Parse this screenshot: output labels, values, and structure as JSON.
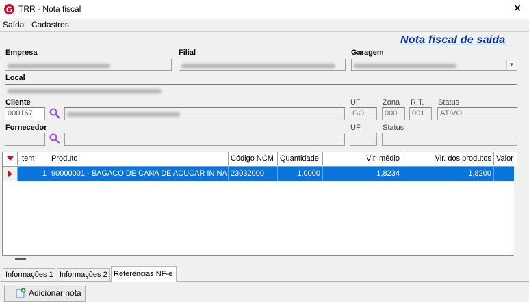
{
  "window": {
    "title": "TRR - Nota fiscal",
    "close_glyph": "✕",
    "app_icon_letter": "G"
  },
  "menu": {
    "items": [
      {
        "label": "Saída"
      },
      {
        "label": "Cadastros"
      }
    ]
  },
  "form": {
    "title": "Nota fiscal de saída",
    "empresa_label": "Empresa",
    "filial_label": "Filial",
    "garagem_label": "Garagem",
    "local_label": "Local",
    "cliente_label": "Cliente",
    "cliente_code": "000167",
    "uf_label": "UF",
    "uf_value": "GO",
    "zona_label": "Zona",
    "zona_value": "000",
    "rt_label": "R.T.",
    "rt_value": "001",
    "status_label": "Status",
    "status_value": "ATIVO",
    "fornecedor_label": "Fornecedor",
    "fornecedor_uf_label": "UF",
    "fornecedor_status_label": "Status"
  },
  "grid": {
    "columns": [
      "Item",
      "Produto",
      "Código NCM",
      "Quantidade",
      "Vlr. médio",
      "Vlr. dos produtos",
      "Valor"
    ],
    "rows": [
      {
        "item": "1",
        "produto": "90000001 - BAGACO DE CANA DE ACUCAR IN NA...",
        "ncm": "23032000",
        "quantidade": "1,0000",
        "vlr_medio": "1,8234",
        "vlr_produtos": "1,8200",
        "valor": ""
      }
    ]
  },
  "tabs": [
    {
      "label": "Informações 1"
    },
    {
      "label": "Informações 2"
    },
    {
      "label": "Referências NF-e"
    }
  ],
  "actions": {
    "add_note_label": "Adicionar nota"
  },
  "colors": {
    "title_blue": "#0a2ea3",
    "selection": "#0a74da",
    "app_red": "#c8102e"
  }
}
